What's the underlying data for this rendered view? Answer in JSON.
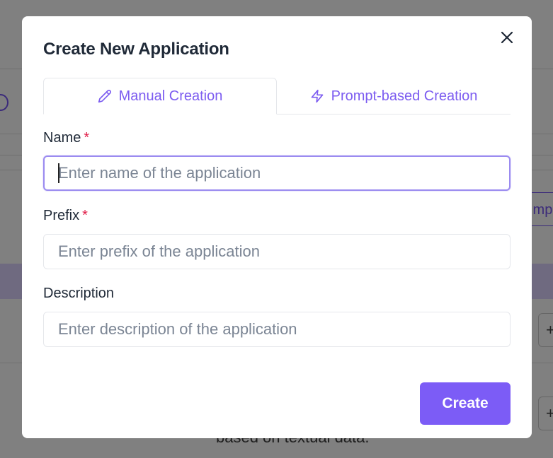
{
  "background": {
    "import_button_label": "Impo",
    "side_button_label": "+",
    "bottom_text": "based on textual data."
  },
  "modal": {
    "title": "Create New Application",
    "close_icon": "close-icon",
    "tabs": [
      {
        "label": "Manual Creation",
        "icon": "pencil-icon",
        "active": true
      },
      {
        "label": "Prompt-based Creation",
        "icon": "lightning-icon",
        "active": false
      }
    ],
    "fields": {
      "name": {
        "label": "Name",
        "required_marker": "*",
        "placeholder": "Enter name of the application",
        "value": ""
      },
      "prefix": {
        "label": "Prefix",
        "required_marker": "*",
        "placeholder": "Enter prefix of the application",
        "value": ""
      },
      "description": {
        "label": "Description",
        "placeholder": "Enter description of the application",
        "value": ""
      }
    },
    "submit_label": "Create"
  },
  "colors": {
    "accent": "#7c5cf6",
    "tab_text": "#7c5cf0",
    "required": "#e11d48",
    "overlay": "#808080"
  }
}
